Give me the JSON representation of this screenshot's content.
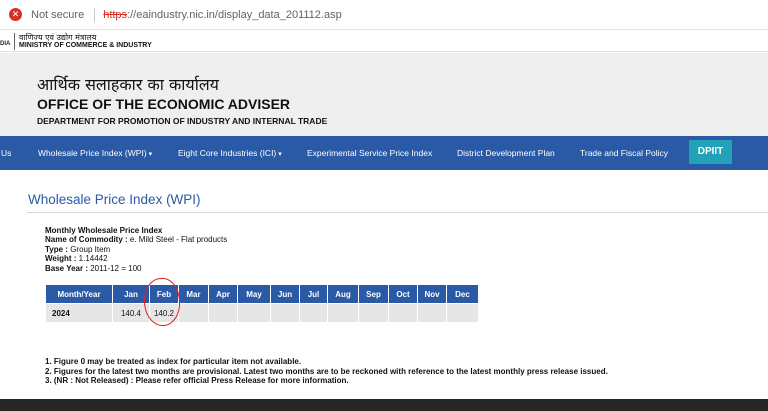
{
  "browser": {
    "security_label": "Not secure",
    "url_protocol": "https",
    "url_rest": "://eaindustry.nic.in/display_data_201112.asp"
  },
  "ministry": {
    "left_fragment": "DIA",
    "hindi": "वाणिज्य एवं उद्योग मंत्रालय",
    "english": "MINISTRY OF COMMERCE & INDUSTRY"
  },
  "banner": {
    "hindi_title": "आर्थिक सलाहकार का कार्यालय",
    "title": "OFFICE OF THE ECONOMIC ADVISER",
    "department": "DEPARTMENT FOR PROMOTION OF INDUSTRY AND INTERNAL TRADE"
  },
  "nav": {
    "items": [
      {
        "label": "Us"
      },
      {
        "label": "Wholesale Price Index (WPI)",
        "caret": "▾"
      },
      {
        "label": "Eight Core Industries (ICI)",
        "caret": "▾"
      },
      {
        "label": "Experimental Service Price Index"
      },
      {
        "label": "District Development Plan"
      },
      {
        "label": "Trade and Fiscal Policy"
      }
    ],
    "dpiit": "DPIIT"
  },
  "section": {
    "title": "Wholesale Price Index (WPI)"
  },
  "info": {
    "heading": "Monthly Wholesale Price Index",
    "commodity_label": "Name of Commodity :",
    "commodity": "e. Mild Steel - Flat products",
    "type_label": "Type :",
    "type": "Group Item",
    "weight_label": "Weight :",
    "weight": "1.14442",
    "base_label": "Base Year :",
    "base": "2011-12 = 100"
  },
  "table": {
    "headers": [
      "Month/Year",
      "Jan",
      "Feb",
      "Mar",
      "Apr",
      "May",
      "Jun",
      "Jul",
      "Aug",
      "Sep",
      "Oct",
      "Nov",
      "Dec"
    ],
    "rows": [
      [
        "2024",
        "140.4",
        "140.2",
        "",
        "",
        "",
        "",
        "",
        "",
        "",
        "",
        "",
        ""
      ]
    ]
  },
  "notes": [
    "1. Figure 0 may be treated as index for particular item not available.",
    "2. Figures for the latest two months are provisional. Latest two months are to be reckoned with reference to the latest monthly press release issued.",
    "3. (NR : Not Released) : Please refer official Press Release for more information."
  ],
  "colors": {
    "nav": "#2a5aa5",
    "dpiit": "#22a2b8",
    "annotation": "#e0201e"
  }
}
